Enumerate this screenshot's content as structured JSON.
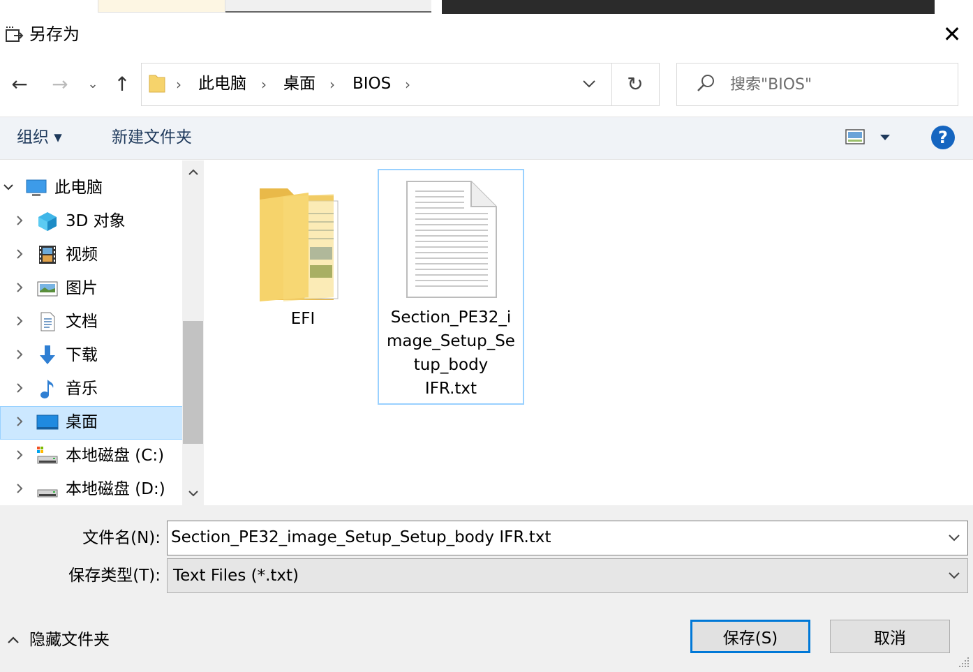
{
  "dialog": {
    "title": "另存为",
    "close_glyph": "✕"
  },
  "navigation": {
    "back_glyph": "←",
    "forward_glyph": "→",
    "recent_glyph": "⌄",
    "up_glyph": "↑"
  },
  "address_bar": {
    "crumbs": [
      "此电脑",
      "桌面",
      "BIOS"
    ],
    "separator": "›",
    "refresh_glyph": "↻"
  },
  "search": {
    "placeholder": "搜索\"BIOS\""
  },
  "toolbar": {
    "organize_label": "组织 ▾",
    "new_folder_label": "新建文件夹",
    "help_glyph": "?"
  },
  "nav_pane": {
    "items": [
      {
        "label": "此电脑",
        "icon": "pc-icon",
        "expanded": true,
        "selected": false
      },
      {
        "label": "3D 对象",
        "icon": "3d-objects-icon",
        "expanded": false,
        "selected": false
      },
      {
        "label": "视频",
        "icon": "video-icon",
        "expanded": false,
        "selected": false
      },
      {
        "label": "图片",
        "icon": "pictures-icon",
        "expanded": false,
        "selected": false
      },
      {
        "label": "文档",
        "icon": "documents-icon",
        "expanded": false,
        "selected": false
      },
      {
        "label": "下载",
        "icon": "download-icon",
        "expanded": false,
        "selected": false
      },
      {
        "label": "音乐",
        "icon": "music-icon",
        "expanded": false,
        "selected": false
      },
      {
        "label": "桌面",
        "icon": "desktop-icon",
        "expanded": false,
        "selected": true
      },
      {
        "label": "本地磁盘 (C:)",
        "icon": "system-drive-icon",
        "expanded": false,
        "selected": false
      },
      {
        "label": "本地磁盘 (D:)",
        "icon": "drive-icon",
        "expanded": false,
        "selected": false
      }
    ]
  },
  "files": [
    {
      "name": "EFI",
      "type": "folder"
    },
    {
      "name_lines": [
        "Section_PE32_i",
        "mage_Setup_Se",
        "tup_body",
        "IFR.txt"
      ],
      "type": "text-file",
      "selected": true
    }
  ],
  "form": {
    "filename_label": "文件名(N):",
    "filename_value": "Section_PE32_image_Setup_Setup_body IFR.txt",
    "filetype_label": "保存类型(T):",
    "filetype_value": "Text Files (*.txt)",
    "hide_folders_label": "隐藏文件夹",
    "save_label": "保存(S)",
    "cancel_label": "取消"
  },
  "colors": {
    "accent": "#0078d7",
    "selection_bg": "#cce8ff",
    "selection_border": "#99d1ff",
    "folder_yellow": "#f6d36b",
    "help_blue": "#1565c0"
  }
}
